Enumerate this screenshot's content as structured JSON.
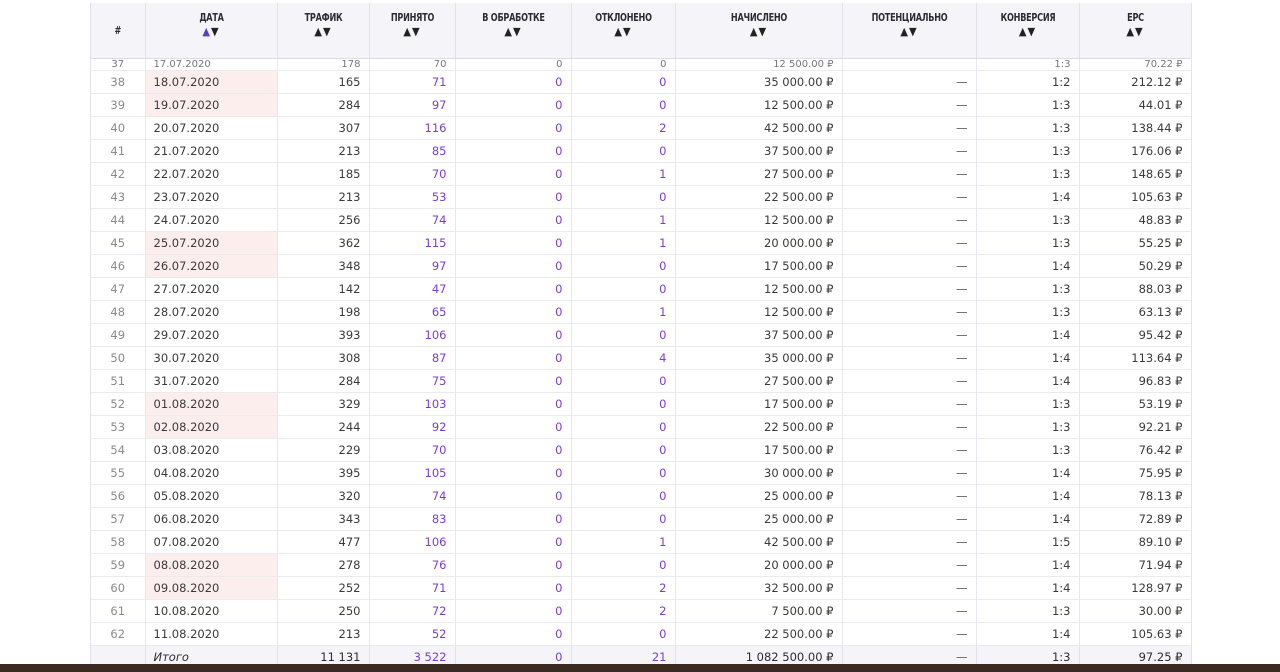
{
  "headers": {
    "num": "#",
    "date": "ДАТА",
    "traffic": "ТРАФИК",
    "accepted": "ПРИНЯТО",
    "processing": "В ОБРАБОТКЕ",
    "rejected": "ОТКЛОНЕНО",
    "accrued": "НАЧИСЛЕНО",
    "potential": "ПОТЕНЦИАЛЬНО",
    "conversion": "КОНВЕРСИЯ",
    "epc": "EPC",
    "sort_asc": "▲",
    "sort_desc": "▼"
  },
  "partial_row": {
    "num": "37",
    "date": "17.07.2020",
    "traffic": "178",
    "accepted": "70",
    "processing": "0",
    "rejected": "0",
    "accrued": "12 500.00 ₽",
    "potential": "",
    "conversion": "1:3",
    "epc": "70.22 ₽"
  },
  "rows": [
    {
      "num": "38",
      "date": "18.07.2020",
      "weekend": true,
      "traffic": "165",
      "accepted": "71",
      "processing": "0",
      "rejected": "0",
      "accrued": "35 000.00 ₽",
      "potential": "—",
      "conversion": "1:2",
      "epc": "212.12 ₽"
    },
    {
      "num": "39",
      "date": "19.07.2020",
      "weekend": true,
      "traffic": "284",
      "accepted": "97",
      "processing": "0",
      "rejected": "0",
      "accrued": "12 500.00 ₽",
      "potential": "—",
      "conversion": "1:3",
      "epc": "44.01 ₽"
    },
    {
      "num": "40",
      "date": "20.07.2020",
      "weekend": false,
      "traffic": "307",
      "accepted": "116",
      "processing": "0",
      "rejected": "2",
      "accrued": "42 500.00 ₽",
      "potential": "—",
      "conversion": "1:3",
      "epc": "138.44 ₽"
    },
    {
      "num": "41",
      "date": "21.07.2020",
      "weekend": false,
      "traffic": "213",
      "accepted": "85",
      "processing": "0",
      "rejected": "0",
      "accrued": "37 500.00 ₽",
      "potential": "—",
      "conversion": "1:3",
      "epc": "176.06 ₽"
    },
    {
      "num": "42",
      "date": "22.07.2020",
      "weekend": false,
      "traffic": "185",
      "accepted": "70",
      "processing": "0",
      "rejected": "1",
      "accrued": "27 500.00 ₽",
      "potential": "—",
      "conversion": "1:3",
      "epc": "148.65 ₽"
    },
    {
      "num": "43",
      "date": "23.07.2020",
      "weekend": false,
      "traffic": "213",
      "accepted": "53",
      "processing": "0",
      "rejected": "0",
      "accrued": "22 500.00 ₽",
      "potential": "—",
      "conversion": "1:4",
      "epc": "105.63 ₽"
    },
    {
      "num": "44",
      "date": "24.07.2020",
      "weekend": false,
      "traffic": "256",
      "accepted": "74",
      "processing": "0",
      "rejected": "1",
      "accrued": "12 500.00 ₽",
      "potential": "—",
      "conversion": "1:3",
      "epc": "48.83 ₽"
    },
    {
      "num": "45",
      "date": "25.07.2020",
      "weekend": true,
      "traffic": "362",
      "accepted": "115",
      "processing": "0",
      "rejected": "1",
      "accrued": "20 000.00 ₽",
      "potential": "—",
      "conversion": "1:3",
      "epc": "55.25 ₽"
    },
    {
      "num": "46",
      "date": "26.07.2020",
      "weekend": true,
      "traffic": "348",
      "accepted": "97",
      "processing": "0",
      "rejected": "0",
      "accrued": "17 500.00 ₽",
      "potential": "—",
      "conversion": "1:4",
      "epc": "50.29 ₽"
    },
    {
      "num": "47",
      "date": "27.07.2020",
      "weekend": false,
      "traffic": "142",
      "accepted": "47",
      "processing": "0",
      "rejected": "0",
      "accrued": "12 500.00 ₽",
      "potential": "—",
      "conversion": "1:3",
      "epc": "88.03 ₽"
    },
    {
      "num": "48",
      "date": "28.07.2020",
      "weekend": false,
      "traffic": "198",
      "accepted": "65",
      "processing": "0",
      "rejected": "1",
      "accrued": "12 500.00 ₽",
      "potential": "—",
      "conversion": "1:3",
      "epc": "63.13 ₽"
    },
    {
      "num": "49",
      "date": "29.07.2020",
      "weekend": false,
      "traffic": "393",
      "accepted": "106",
      "processing": "0",
      "rejected": "0",
      "accrued": "37 500.00 ₽",
      "potential": "—",
      "conversion": "1:4",
      "epc": "95.42 ₽"
    },
    {
      "num": "50",
      "date": "30.07.2020",
      "weekend": false,
      "traffic": "308",
      "accepted": "87",
      "processing": "0",
      "rejected": "4",
      "accrued": "35 000.00 ₽",
      "potential": "—",
      "conversion": "1:4",
      "epc": "113.64 ₽"
    },
    {
      "num": "51",
      "date": "31.07.2020",
      "weekend": false,
      "traffic": "284",
      "accepted": "75",
      "processing": "0",
      "rejected": "0",
      "accrued": "27 500.00 ₽",
      "potential": "—",
      "conversion": "1:4",
      "epc": "96.83 ₽"
    },
    {
      "num": "52",
      "date": "01.08.2020",
      "weekend": true,
      "traffic": "329",
      "accepted": "103",
      "processing": "0",
      "rejected": "0",
      "accrued": "17 500.00 ₽",
      "potential": "—",
      "conversion": "1:3",
      "epc": "53.19 ₽"
    },
    {
      "num": "53",
      "date": "02.08.2020",
      "weekend": true,
      "traffic": "244",
      "accepted": "92",
      "processing": "0",
      "rejected": "0",
      "accrued": "22 500.00 ₽",
      "potential": "—",
      "conversion": "1:3",
      "epc": "92.21 ₽"
    },
    {
      "num": "54",
      "date": "03.08.2020",
      "weekend": false,
      "traffic": "229",
      "accepted": "70",
      "processing": "0",
      "rejected": "0",
      "accrued": "17 500.00 ₽",
      "potential": "—",
      "conversion": "1:3",
      "epc": "76.42 ₽"
    },
    {
      "num": "55",
      "date": "04.08.2020",
      "weekend": false,
      "traffic": "395",
      "accepted": "105",
      "processing": "0",
      "rejected": "0",
      "accrued": "30 000.00 ₽",
      "potential": "—",
      "conversion": "1:4",
      "epc": "75.95 ₽"
    },
    {
      "num": "56",
      "date": "05.08.2020",
      "weekend": false,
      "traffic": "320",
      "accepted": "74",
      "processing": "0",
      "rejected": "0",
      "accrued": "25 000.00 ₽",
      "potential": "—",
      "conversion": "1:4",
      "epc": "78.13 ₽"
    },
    {
      "num": "57",
      "date": "06.08.2020",
      "weekend": false,
      "traffic": "343",
      "accepted": "83",
      "processing": "0",
      "rejected": "0",
      "accrued": "25 000.00 ₽",
      "potential": "—",
      "conversion": "1:4",
      "epc": "72.89 ₽"
    },
    {
      "num": "58",
      "date": "07.08.2020",
      "weekend": false,
      "traffic": "477",
      "accepted": "106",
      "processing": "0",
      "rejected": "1",
      "accrued": "42 500.00 ₽",
      "potential": "—",
      "conversion": "1:5",
      "epc": "89.10 ₽"
    },
    {
      "num": "59",
      "date": "08.08.2020",
      "weekend": true,
      "traffic": "278",
      "accepted": "76",
      "processing": "0",
      "rejected": "0",
      "accrued": "20 000.00 ₽",
      "potential": "—",
      "conversion": "1:4",
      "epc": "71.94 ₽"
    },
    {
      "num": "60",
      "date": "09.08.2020",
      "weekend": true,
      "traffic": "252",
      "accepted": "71",
      "processing": "0",
      "rejected": "2",
      "accrued": "32 500.00 ₽",
      "potential": "—",
      "conversion": "1:4",
      "epc": "128.97 ₽"
    },
    {
      "num": "61",
      "date": "10.08.2020",
      "weekend": false,
      "traffic": "250",
      "accepted": "72",
      "processing": "0",
      "rejected": "2",
      "accrued": "7 500.00 ₽",
      "potential": "—",
      "conversion": "1:3",
      "epc": "30.00 ₽"
    },
    {
      "num": "62",
      "date": "11.08.2020",
      "weekend": false,
      "traffic": "213",
      "accepted": "52",
      "processing": "0",
      "rejected": "0",
      "accrued": "22 500.00 ₽",
      "potential": "—",
      "conversion": "1:4",
      "epc": "105.63 ₽"
    }
  ],
  "totals": {
    "label": "Итого",
    "traffic": "11 131",
    "accepted": "3 522",
    "processing": "0",
    "rejected": "21",
    "accrued": "1 082 500.00 ₽",
    "potential": "—",
    "conversion": "1:3",
    "epc": "97.25 ₽"
  },
  "colors": {
    "accent_purple": "#7a3fc8",
    "weekend_bg": "#fdeeee",
    "header_bg": "#f5f4f8"
  }
}
